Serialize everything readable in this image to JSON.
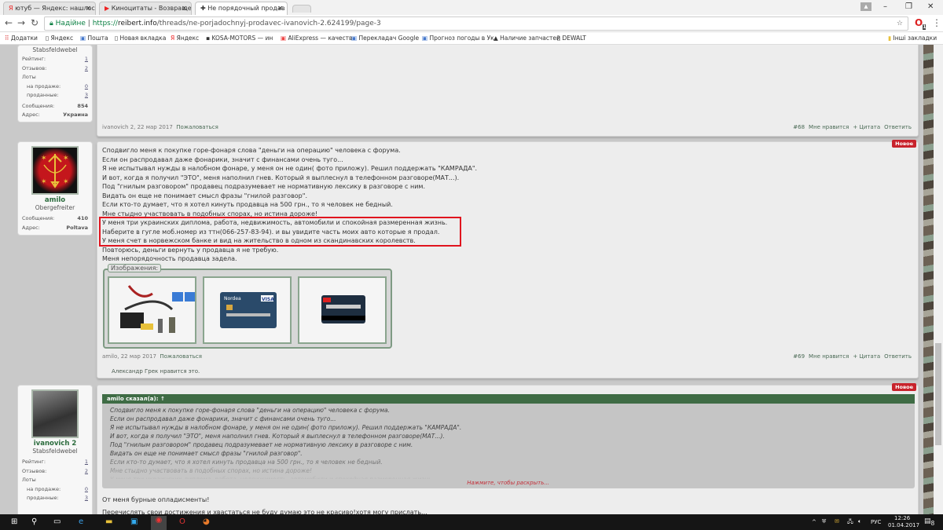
{
  "browser": {
    "tabs": [
      {
        "label": "ютуб — Яндекс: нашлос",
        "icon": "yandex-icon"
      },
      {
        "label": "Киноцитаты - Возвраще",
        "icon": "youtube-icon"
      },
      {
        "label": "Не порядочный продав",
        "icon": "site-icon"
      }
    ],
    "security_label": "Надійне",
    "url_scheme": "https://",
    "url_host": "reibert.info",
    "url_path": "/threads/ne-porjadochnyj-prodavec-ivanovich-2.624199/page-3",
    "bookmarks": [
      "Додатки",
      "Яндекс",
      "Пошта",
      "Новая вкладка",
      "Яндекс",
      "KOSA-MOTORS — ин",
      "AliExpress — качеств",
      "Перекладач Google",
      "Прогноз погоды в Ук",
      "Наличие запчастей :",
      "DEWALT"
    ],
    "other_bookmarks": "Інші закладки",
    "extension_badge": "1"
  },
  "post68": {
    "user": {
      "title": "Stabsfeldwebel",
      "stats": [
        {
          "label": "Рейтинг:",
          "value": "1"
        },
        {
          "label": "Отзывов:",
          "value": "2"
        },
        {
          "label": "Лоты",
          "value": ""
        },
        {
          "label": "на продаже:",
          "value": "0"
        },
        {
          "label": "проданные:",
          "value": "3"
        }
      ],
      "messages_label": "Сообщения:",
      "messages": "854",
      "address_label": "Адрес:",
      "address": "Украина"
    },
    "author_date": "ivanovich 2, 22 мар 2017",
    "report": "Пожаловаться",
    "number": "#68",
    "like": "Мне нравится",
    "quote": "+ Цитата",
    "reply": "Ответить"
  },
  "post69": {
    "badge": "Новое",
    "user": {
      "name": "amilo",
      "title": "Obergefreiter",
      "messages_label": "Сообщения:",
      "messages": "410",
      "address_label": "Адрес:",
      "address": "Poltava"
    },
    "lines": [
      "Сподвигло меня к покупке горе-фонаря слова \"деньги на операцию\" человека с форума.",
      "Если он распродавал даже фонарики, значит с финансами очень туго...",
      "Я не испытывал нужды в налобном фонаре, у меня он не один( фото приложу). Решил поддержать \"КАМРАДА\".",
      "И вот, когда я получил \"ЭТО\", меня наполнил гнев. Который я выплеснул в телефонном разговоре(МАТ...).",
      "Под \"гнилым разговором\" продавец подразумевает не нормативную лексику в разговоре с ним.",
      "Видать он еще не понимает смысл фразы \"гнилой разговор\".",
      "Если кто-то думает, что я хотел кинуть продавца на 500 грн., то я человек не бедный.",
      "Мне стыдно участвовать в подобных спорах, но истина дороже!",
      "У меня три украинских диплома, работа, недвижимость, автомобили и спокойная размеренная жизнь.",
      "Наберите в гугле моб.номер из ттн(066-257-83-94). и вы увидите часть моих авто которые я продал.",
      "У меня счет в норвежском банке и вид на жительство в одном из скандинавских королевств.",
      "Повторюсь, деньги вернуть у продавца я не требую.",
      "Меня непорядочность продавца задела."
    ],
    "images_label": "Изображения:",
    "card_brand": "Nordea",
    "card_network": "VISA",
    "author_date": "amilo, 22 мар 2017",
    "report": "Пожаловаться",
    "number": "#69",
    "like": "Мне нравится",
    "quote": "+ Цитата",
    "reply": "Ответить",
    "likes_text": "Александр Грек нравится это."
  },
  "post70": {
    "badge": "Новое",
    "user": {
      "name": "ivanovich 2",
      "title": "Stabsfeldwebel",
      "stats": [
        {
          "label": "Рейтинг:",
          "value": "1"
        },
        {
          "label": "Отзывов:",
          "value": "2"
        },
        {
          "label": "Лоты",
          "value": ""
        },
        {
          "label": "на продаже:",
          "value": "0"
        },
        {
          "label": "проданные:",
          "value": "3"
        }
      ]
    },
    "quote_header": "amilo сказал(а): ↑",
    "quote_lines": [
      "Сподвигло меня к покупке горе-фонаря слова \"деньги на операцию\" человека с форума.",
      "Если он распродавал даже фонарики, значит с финансами очень туго...",
      "Я не испытывал нужды в налобном фонаре, у меня он не один( фото приложу). Решил поддержать \"КАМРАДА\".",
      "И вот, когда я получил \"ЭТО\", меня наполнил гнев. Который я выплеснул в телефонном разговоре(МАТ...).",
      "Под \"гнилым разговором\" продавец подразумевает не нормативную лексику в разговоре с ним.",
      "Видать он еще не понимает смысл фразы \"гнилой разговор\".",
      "Если кто-то думает, что я хотел кинуть продавца на 500 грн., то я человек не бедный.",
      "Мне стыдно участвовать в подобных спорах, но истина дороже!",
      "У меня три украинских диплома, работа, недвижимость, автомобили и спокойная размеренная жизнь."
    ],
    "expand": "Нажмите, чтобы раскрыть...",
    "lines": [
      "От меня бурные опладисменты!",
      "Перечислять свои достижения и хвастаться не буду думаю это не красиво!хотя могу прислать..."
    ]
  },
  "taskbar": {
    "lang": "РУС",
    "time": "12:26",
    "date": "01.04.2017",
    "notifications": "8"
  }
}
